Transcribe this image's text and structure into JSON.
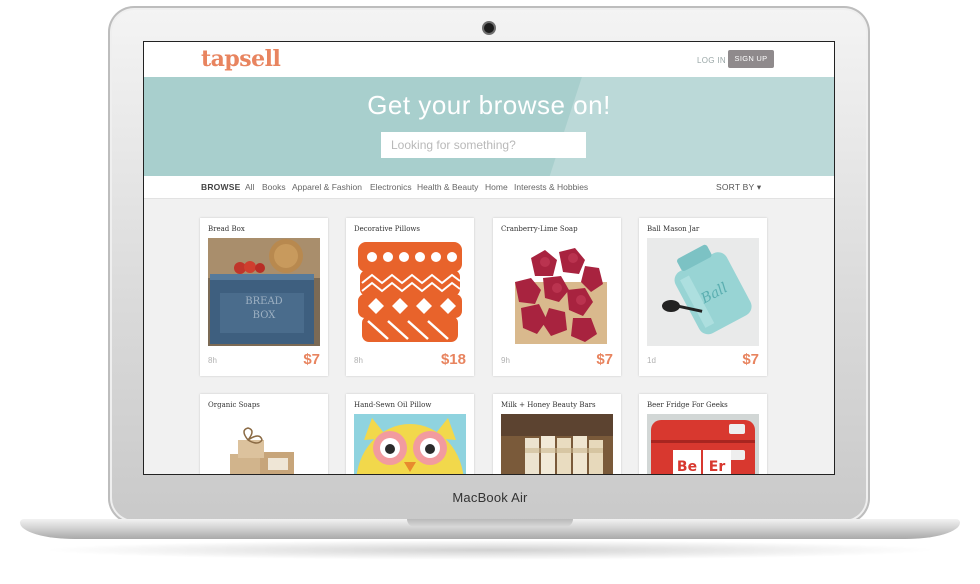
{
  "device": {
    "label": "MacBook Air"
  },
  "site": {
    "logo": "tapsell",
    "login_label": "LOG IN",
    "signup_label": "SIGN UP",
    "hero_title": "Get your browse on!",
    "search_placeholder": "Looking for something?",
    "accent_color": "#e8845f",
    "hero_color": "#a8cfcd"
  },
  "nav": {
    "browse_label": "BROWSE",
    "items": [
      "All",
      "Books",
      "Apparel & Fashion",
      "Electronics",
      "Health & Beauty",
      "Home",
      "Interests & Hobbies"
    ],
    "sort_label": "SORT BY ▾"
  },
  "products": [
    {
      "title": "Bread Box",
      "age": "8h",
      "price": "$7",
      "image": "bread-box-photo"
    },
    {
      "title": "Decorative Pillows",
      "age": "8h",
      "price": "$18",
      "image": "orange-pillows-photo"
    },
    {
      "title": "Cranberry-Lime Soap",
      "age": "9h",
      "price": "$7",
      "image": "cranberry-soap-photo"
    },
    {
      "title": "Ball Mason Jar",
      "age": "1d",
      "price": "$7",
      "image": "mason-jar-photo"
    },
    {
      "title": "Organic Soaps",
      "image": "organic-soaps-photo"
    },
    {
      "title": "Hand-Sewn Oil Pillow",
      "image": "owl-pillow-photo"
    },
    {
      "title": "Milk + Honey Beauty Bars",
      "image": "beauty-bars-photo"
    },
    {
      "title": "Beer Fridge For Geeks",
      "image": "beer-fridge-photo",
      "image_text": [
        "Be",
        "Er"
      ]
    }
  ]
}
